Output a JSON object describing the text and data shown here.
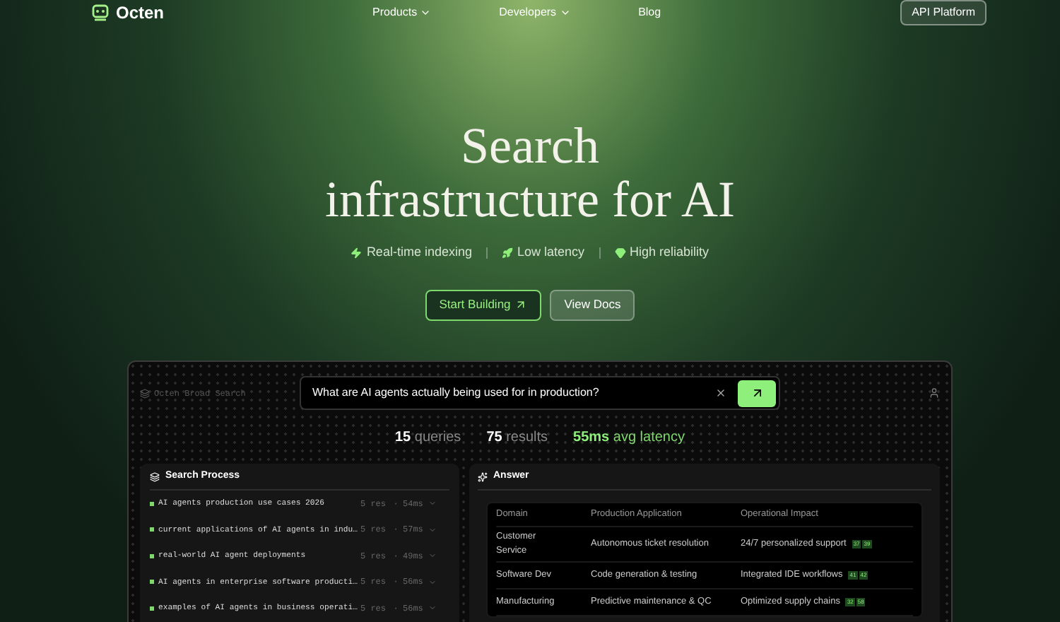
{
  "nav": {
    "brand": "Octen",
    "links": [
      {
        "label": "Products",
        "dropdown": true
      },
      {
        "label": "Developers",
        "dropdown": true
      },
      {
        "label": "Blog",
        "dropdown": false
      }
    ],
    "cta": "API Platform"
  },
  "hero": {
    "title_line_1": "Search",
    "title_line_2": "infrastructure for AI",
    "features": [
      {
        "kind": "bolt",
        "label": "Real-time indexing"
      },
      {
        "kind": "rocket",
        "label": "Low latency"
      },
      {
        "kind": "gem",
        "label": "High reliability"
      }
    ],
    "buttons": [
      {
        "label": "Start Building",
        "primary": true
      },
      {
        "label": "View Docs",
        "primary": false
      }
    ]
  },
  "demo": {
    "app_name": "Octen Broad Search",
    "query": "What are AI agents actually being used for in production?",
    "stats": [
      {
        "text": "**15** queries",
        "highlight": false
      },
      {
        "text": "**75** results",
        "highlight": false
      },
      {
        "text": "**55ms** avg latency",
        "highlight": true
      }
    ],
    "search_process": {
      "title": "Search Process",
      "rows": [
        {
          "query": "AI agents production use cases 2026",
          "results": "5 res",
          "separator": "·",
          "time": "54ms"
        },
        {
          "query": "current applications of AI agents in indu…",
          "results": "5 res",
          "separator": "·",
          "time": "57ms"
        },
        {
          "query": "real-world AI agent deployments",
          "results": "5 res",
          "separator": "·",
          "time": "49ms"
        },
        {
          "query": "AI agents in enterprise software producti…",
          "results": "5 res",
          "separator": "·",
          "time": "56ms"
        },
        {
          "query": "examples of AI agents in business operati…",
          "results": "5 res",
          "separator": "·",
          "time": "56ms"
        }
      ]
    },
    "answer": {
      "title": "Answer",
      "columns": [
        "Domain",
        "Production Application",
        "Operational Impact"
      ],
      "rows": [
        {
          "cells": [
            "Customer Service",
            "Autonomous ticket resolution",
            "24/7 personalized support"
          ],
          "citations": [
            "37",
            "39"
          ]
        },
        {
          "cells": [
            "Software Dev",
            "Code generation & testing",
            "Integrated IDE workflows"
          ],
          "citations": [
            "41",
            "42"
          ]
        },
        {
          "cells": [
            "Manufacturing",
            "Predictive maintenance & QC",
            "Optimized supply chains"
          ],
          "citations": [
            "32",
            "58"
          ]
        }
      ]
    }
  }
}
